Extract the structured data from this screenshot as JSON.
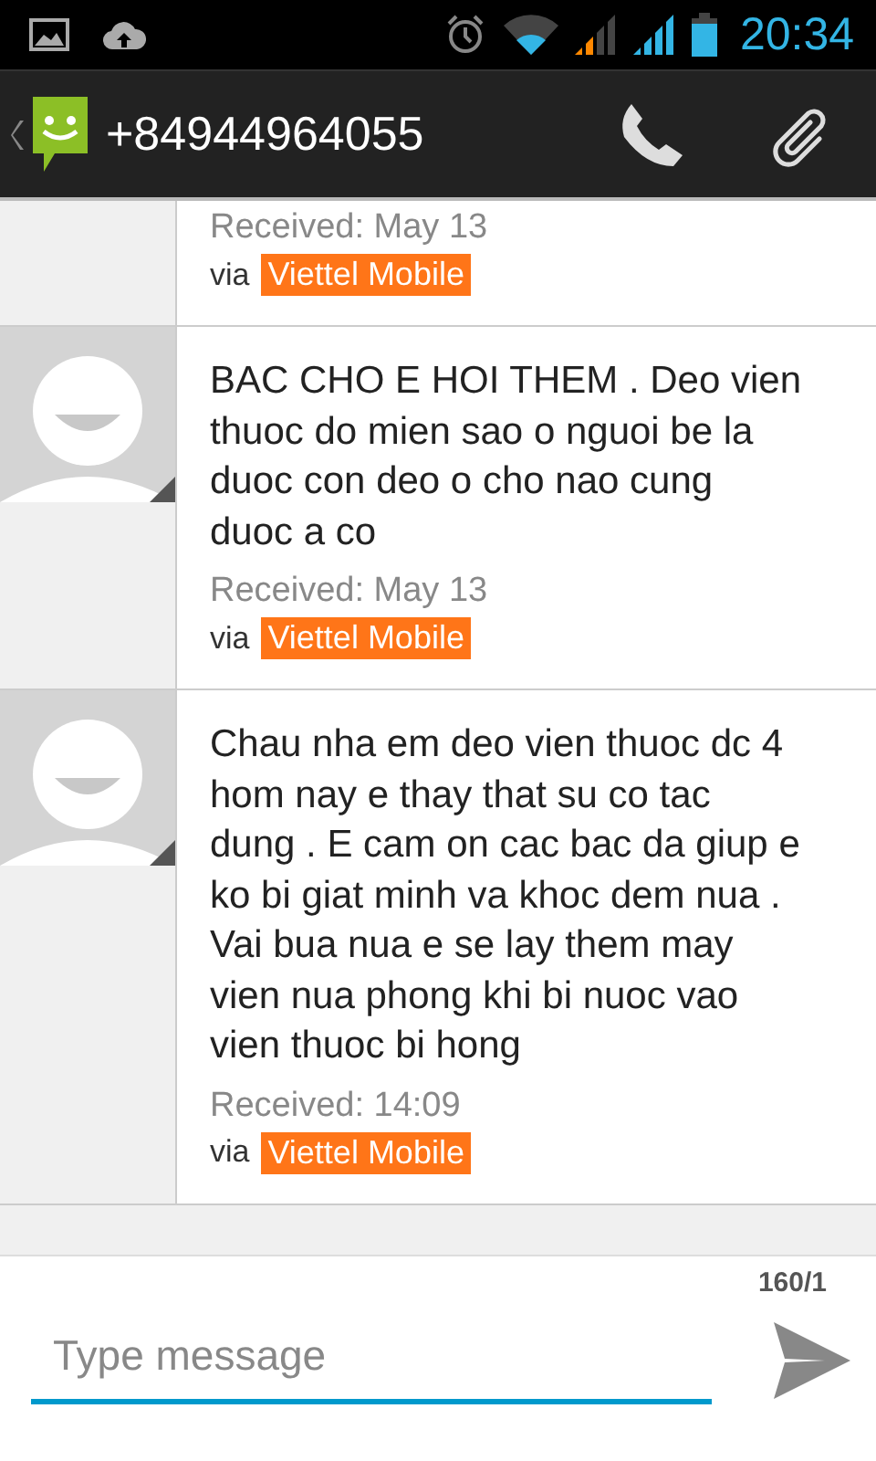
{
  "status_bar": {
    "time": "20:34"
  },
  "header": {
    "contact": "+84944964055"
  },
  "messages": [
    {
      "avatar": false,
      "received": "Received: May 13",
      "via": "via",
      "carrier": "Viettel Mobile"
    },
    {
      "avatar": true,
      "body": "BAC CHO E HOI THEM . Deo vien thuoc do mien sao o nguoi be la duoc con deo o cho nao cung duoc a co",
      "received": "Received: May 13",
      "via": "via",
      "carrier": "Viettel Mobile"
    },
    {
      "avatar": true,
      "body": "Chau nha em deo vien thuoc dc 4 hom nay e thay that su co tac dung . E cam on cac bac da giup e ko bi giat minh va khoc dem nua . Vai bua nua e se lay them may vien nua phong khi bi nuoc vao vien thuoc bi hong",
      "received": "Received: 14:09",
      "via": "via",
      "carrier": "Viettel Mobile"
    }
  ],
  "composer": {
    "counter": "160/1",
    "placeholder": "Type message"
  }
}
